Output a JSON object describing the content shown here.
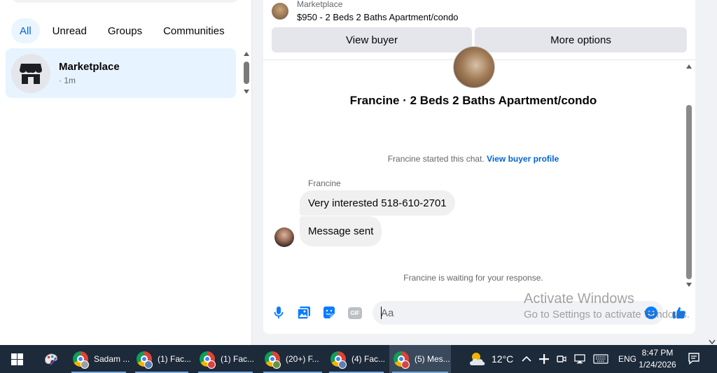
{
  "left_panel": {
    "filters": [
      {
        "label": "All",
        "active": true
      },
      {
        "label": "Unread"
      },
      {
        "label": "Groups"
      },
      {
        "label": "Communities"
      }
    ],
    "conversation": {
      "name": "Marketplace",
      "time": "· 1m"
    }
  },
  "chat": {
    "listing": {
      "label": "Marketplace",
      "title": "$950 - 2 Beds 2 Baths Apartment/condo"
    },
    "buttons": {
      "view_buyer": "View buyer",
      "more_options": "More options"
    },
    "heading": "Francine · 2 Beds 2 Baths Apartment/condo",
    "started_text": "Francine started this chat.",
    "started_link": "View buyer profile",
    "sender_name": "Francine",
    "messages": [
      "Very interested 518-610-2701",
      "Message sent"
    ],
    "waiting_text": "Francine is waiting for your response.",
    "composer": {
      "placeholder": "Aa",
      "gif_label": "GIF"
    }
  },
  "watermark": {
    "line1": "Activate Windows",
    "line2": "Go to Settings to activate Windows."
  },
  "taskbar": {
    "apps": [
      {
        "label": "Sadam ..."
      },
      {
        "label": "(1) Fac..."
      },
      {
        "label": "(1) Fac..."
      },
      {
        "label": "(20+) F..."
      },
      {
        "label": "(4) Fac..."
      },
      {
        "label": "(5) Mes..."
      }
    ],
    "weather": "12°C",
    "language": "ENG",
    "time": "8:47 PM",
    "date": "1/24/2026"
  },
  "colors": {
    "accent": "#0064d1",
    "bubble": "#f0f0f0",
    "selected": "#e7f3ff",
    "taskbar": "#1c2a3a"
  }
}
